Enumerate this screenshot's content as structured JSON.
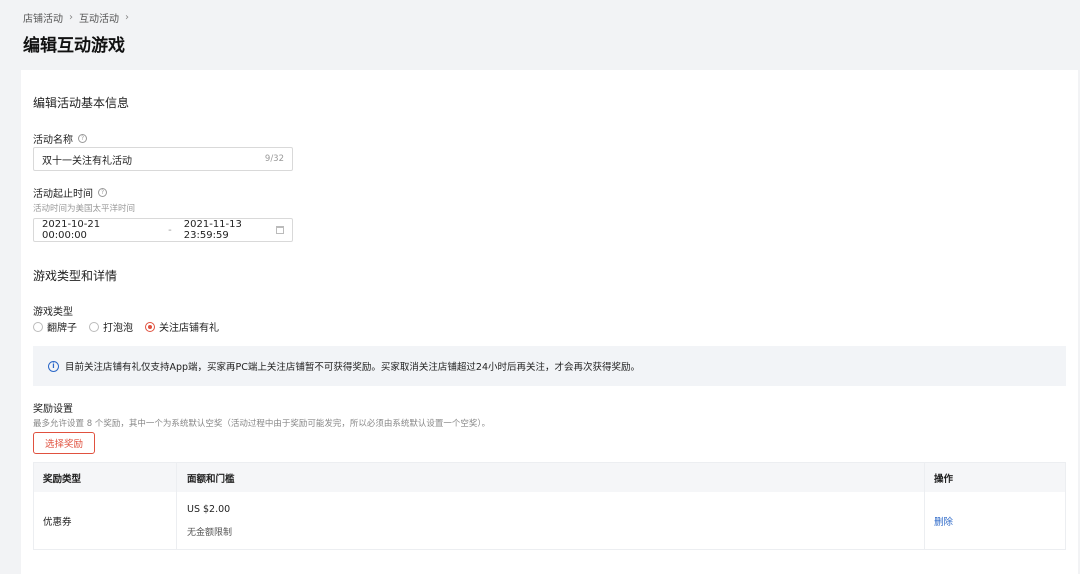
{
  "breadcrumb": {
    "items": [
      "店铺活动",
      "互动活动"
    ],
    "sep": "›"
  },
  "page_title": "编辑互动游戏",
  "basic_section": {
    "title": "编辑活动基本信息",
    "name_label": "活动名称",
    "name_value": "双十一关注有礼活动",
    "name_count": "9/32",
    "time_label": "活动起止时间",
    "time_hint": "活动时间为美国太平洋时间",
    "start_time": "2021-10-21 00:00:00",
    "range_sep": "-",
    "end_time": "2021-11-13 23:59:59"
  },
  "game_section": {
    "title": "游戏类型和详情",
    "type_label": "游戏类型",
    "types": [
      {
        "label": "翻牌子",
        "selected": false
      },
      {
        "label": "打泡泡",
        "selected": false
      },
      {
        "label": "关注店铺有礼",
        "selected": true
      }
    ],
    "notice_icon": "info-icon",
    "notice": "目前关注店铺有礼仅支持App端，买家再PC端上关注店铺暂不可获得奖励。买家取消关注店铺超过24小时后再关注，才会再次获得奖励。"
  },
  "reward_section": {
    "title": "奖励设置",
    "hint": "最多允许设置 8 个奖励，其中一个为系统默认空奖（活动过程中由于奖励可能发完，所以必须由系统默认设置一个空奖）。",
    "select_button": "选择奖励",
    "columns": [
      "奖励类型",
      "面额和门槛",
      "操作"
    ],
    "rows": [
      {
        "type": "优惠券",
        "amount": "US $2.00",
        "threshold": "无金额限制",
        "action": "删除"
      }
    ]
  },
  "colors": {
    "accent": "#e0513f",
    "link": "#2c68c8"
  }
}
